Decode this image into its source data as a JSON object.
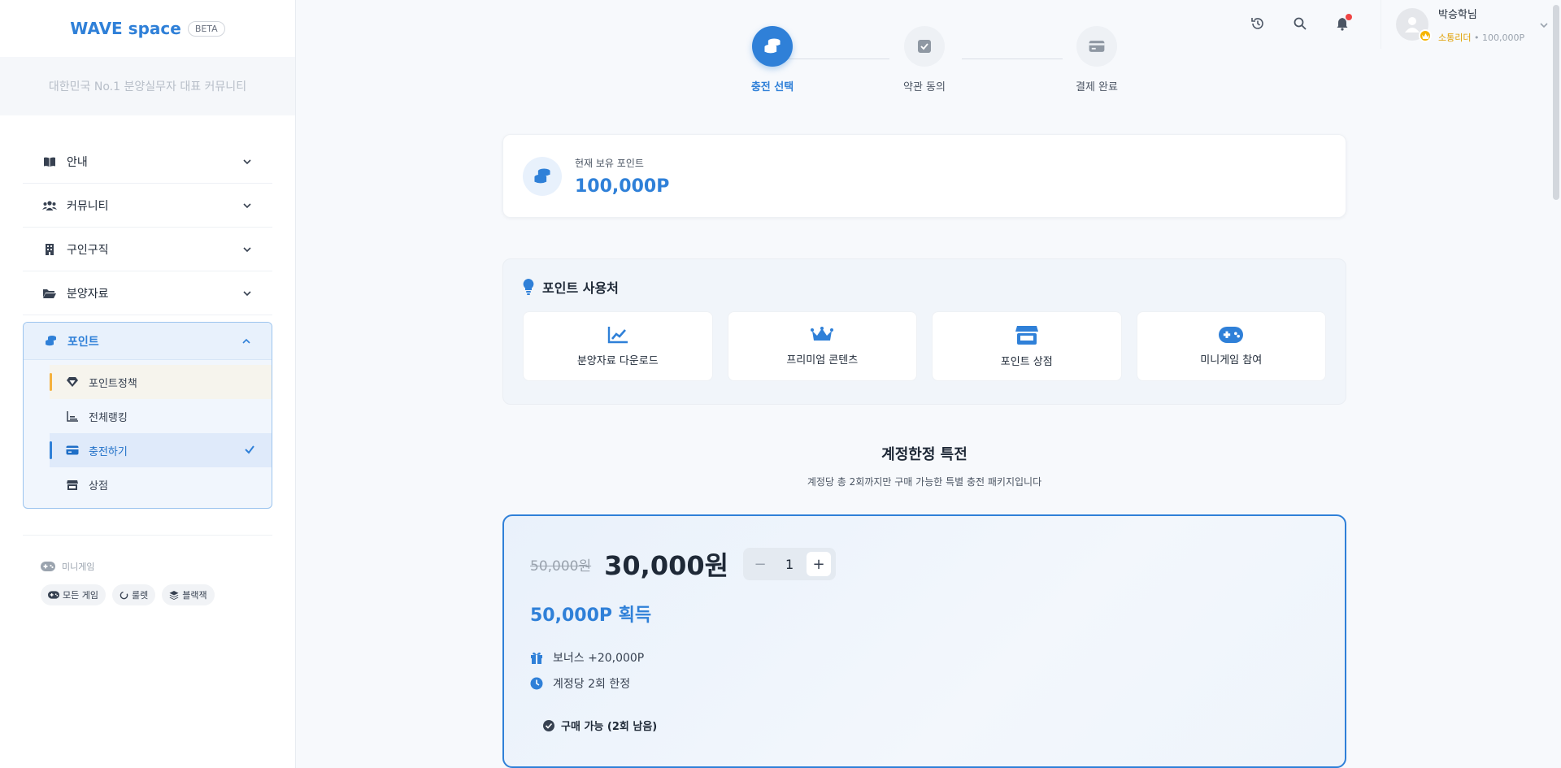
{
  "brand": {
    "name": "WAVE space",
    "badge": "BETA",
    "tagline": "대한민국 No.1 분양실무자 대표 커뮤니티"
  },
  "menu": {
    "items": [
      {
        "label": "안내",
        "icon": "book-icon"
      },
      {
        "label": "커뮤니티",
        "icon": "users-icon"
      },
      {
        "label": "구인구직",
        "icon": "building-icon"
      },
      {
        "label": "분양자료",
        "icon": "folder-icon"
      }
    ],
    "points": {
      "label": "포인트",
      "icon": "coins-icon",
      "sub": [
        {
          "label": "포인트정책",
          "icon": "diamond-icon"
        },
        {
          "label": "전체랭킹",
          "icon": "chart-icon"
        },
        {
          "label": "충전하기",
          "icon": "credit-card-icon"
        },
        {
          "label": "상점",
          "icon": "store-icon"
        }
      ]
    }
  },
  "minigame": {
    "title": "미니게임",
    "chips": [
      {
        "label": "모든 게임",
        "icon": "gamepad-icon"
      },
      {
        "label": "룰렛",
        "icon": "spinner-icon"
      },
      {
        "label": "블랙잭",
        "icon": "layers-icon"
      }
    ]
  },
  "header": {
    "icons": [
      "history-icon",
      "search-icon",
      "bell-icon"
    ],
    "profile": {
      "name": "박승학님",
      "rank": "소통리더",
      "points": "100,000P",
      "separator": "•"
    }
  },
  "stepper": {
    "steps": [
      {
        "label": "충전 선택",
        "icon": "coins-icon",
        "active": true
      },
      {
        "label": "약관 동의",
        "icon": "checkbox-icon",
        "active": false
      },
      {
        "label": "결제 완료",
        "icon": "credit-card-icon",
        "active": false
      }
    ]
  },
  "current_points": {
    "label": "현재 보유 포인트",
    "value": "100,000P"
  },
  "usage": {
    "title": "포인트 사용처",
    "items": [
      {
        "label": "분양자료 다운로드",
        "icon": "line-chart-icon"
      },
      {
        "label": "프리미엄 콘텐츠",
        "icon": "crown-icon"
      },
      {
        "label": "포인트 상점",
        "icon": "store-icon"
      },
      {
        "label": "미니게임 참여",
        "icon": "gamepad-icon"
      }
    ]
  },
  "special": {
    "title": "계정한정 특전",
    "subtitle": "계정당 총 2회까지만 구매 가능한 특별 충전 패키지입니다"
  },
  "offer": {
    "original_price": "50,000원",
    "price": "30,000원",
    "quantity": "1",
    "minus": "−",
    "plus": "+",
    "earn": "50,000P 획득",
    "bonus": "보너스 +20,000P",
    "limit": "계정당 2회 한정",
    "status": "구매 가능 (2회 남음)"
  },
  "colors": {
    "accent": "#2f80d8",
    "gold": "#f5b400",
    "notify": "#ef4444"
  }
}
